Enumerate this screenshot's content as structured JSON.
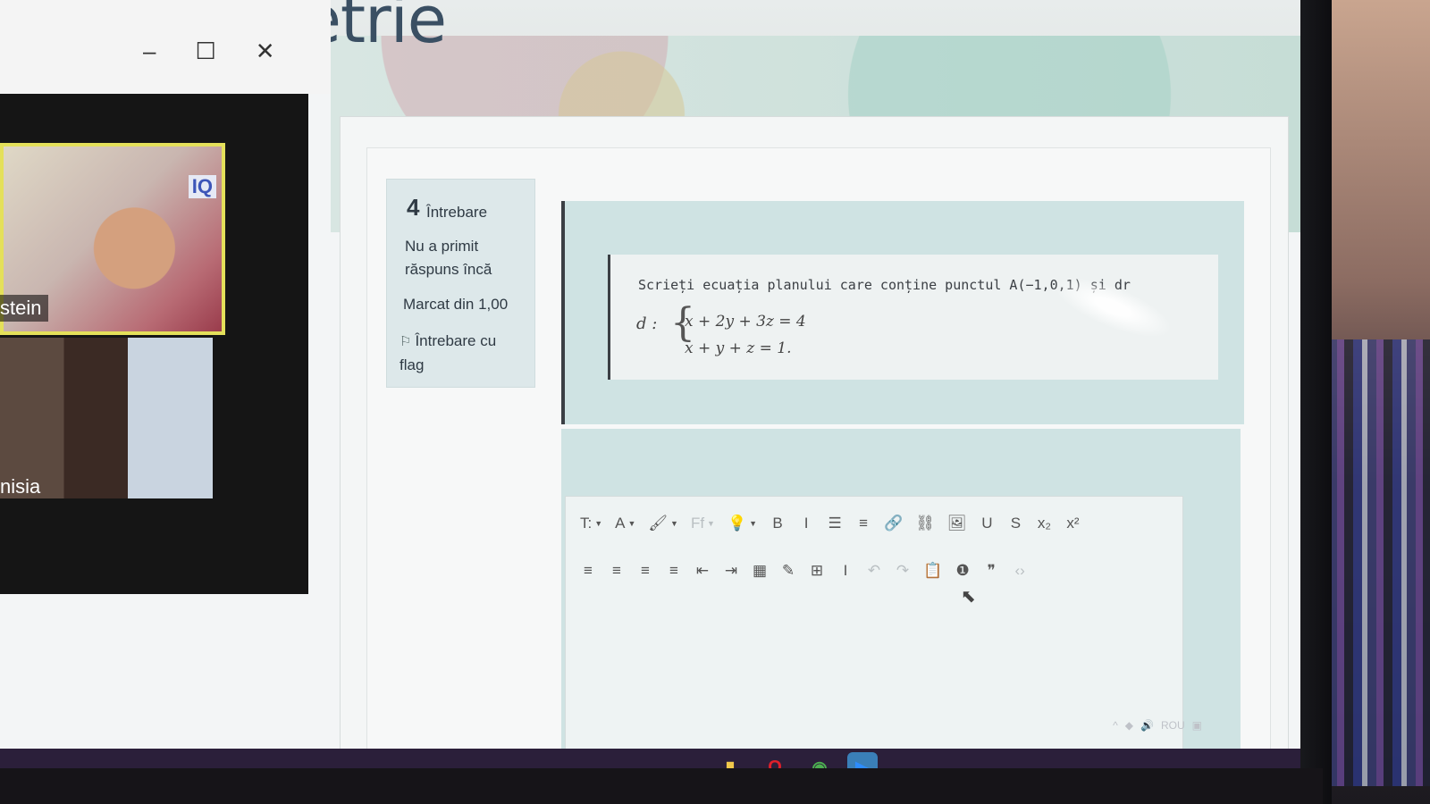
{
  "page": {
    "title": "si geometrie"
  },
  "question_info": {
    "number": "4",
    "number_label": "Întrebare",
    "state": "Nu a primit răspuns încă",
    "mark": "Marcat din 1,00",
    "flag_label": "Întrebare cu flag"
  },
  "question": {
    "text": "Scrieți ecuația planului care conține punctul A(−1,0,1) și dr",
    "line_label": "d :",
    "equation_1": "x + 2y + 3z = 4",
    "equation_2": "x +  y +  z = 1."
  },
  "editor": {
    "toolbar_row1": [
      {
        "label": "T:",
        "icon": "paragraph-style-icon",
        "dropdown": true
      },
      {
        "label": "A",
        "icon": "font-color-icon",
        "dropdown": true
      },
      {
        "label": "🖌",
        "icon": "background-color-icon",
        "dropdown": true
      },
      {
        "label": "Ff",
        "icon": "font-family-icon",
        "dropdown": true,
        "disabled": true
      },
      {
        "label": "💡",
        "icon": "styles-icon",
        "dropdown": true
      },
      {
        "label": "B",
        "icon": "bold-icon"
      },
      {
        "label": "I",
        "icon": "italic-icon"
      },
      {
        "label": "☰",
        "icon": "unordered-list-icon"
      },
      {
        "label": "≡",
        "icon": "ordered-list-icon"
      },
      {
        "label": "🔗",
        "icon": "link-icon"
      },
      {
        "label": "⛓",
        "icon": "unlink-icon"
      },
      {
        "label": "🖼",
        "icon": "image-icon"
      },
      {
        "label": "U",
        "icon": "underline-icon"
      },
      {
        "label": "S",
        "icon": "strikethrough-icon"
      },
      {
        "label": "x₂",
        "icon": "subscript-icon"
      },
      {
        "label": "x²",
        "icon": "superscript-icon"
      }
    ],
    "toolbar_row2": [
      {
        "label": "≡",
        "icon": "align-left-icon"
      },
      {
        "label": "≡",
        "icon": "align-center-icon"
      },
      {
        "label": "≡",
        "icon": "align-right-icon"
      },
      {
        "label": "≡",
        "icon": "align-justify-icon"
      },
      {
        "label": "⇤",
        "icon": "outdent-icon"
      },
      {
        "label": "⇥",
        "icon": "indent-icon"
      },
      {
        "label": "▦",
        "icon": "equation-icon"
      },
      {
        "label": "✎",
        "icon": "edit-icon"
      },
      {
        "label": "⊞",
        "icon": "table-icon"
      },
      {
        "label": "I",
        "icon": "clear-formatting-icon"
      },
      {
        "label": "↶",
        "icon": "undo-icon",
        "disabled": true
      },
      {
        "label": "↷",
        "icon": "redo-icon",
        "disabled": true
      },
      {
        "label": "📋",
        "icon": "paste-icon"
      },
      {
        "label": "❶",
        "icon": "accessibility-checker-icon"
      },
      {
        "label": "❞",
        "icon": "screen-reader-icon"
      },
      {
        "label": "‹›",
        "icon": "html-icon",
        "disabled": true
      }
    ]
  },
  "call": {
    "participant_1": "stein",
    "participant_1_logo": "IQ",
    "participant_2": "nisia"
  },
  "taskbar": {
    "apps": [
      {
        "icon": "file-explorer-icon",
        "color": "#f1c84b"
      },
      {
        "icon": "opera-icon",
        "color": "#e0202a",
        "label": "O"
      },
      {
        "icon": "chrome-icon",
        "color": "#4caf50",
        "label": "◉"
      },
      {
        "icon": "zoom-icon",
        "color": "#2d8cff",
        "label": "▶"
      }
    ],
    "tray_lang": "ROU"
  },
  "colors": {
    "accent": "#cfe3e3",
    "taskbar": "#2b1f3a",
    "active_speaker_border": "#e4e05a"
  }
}
